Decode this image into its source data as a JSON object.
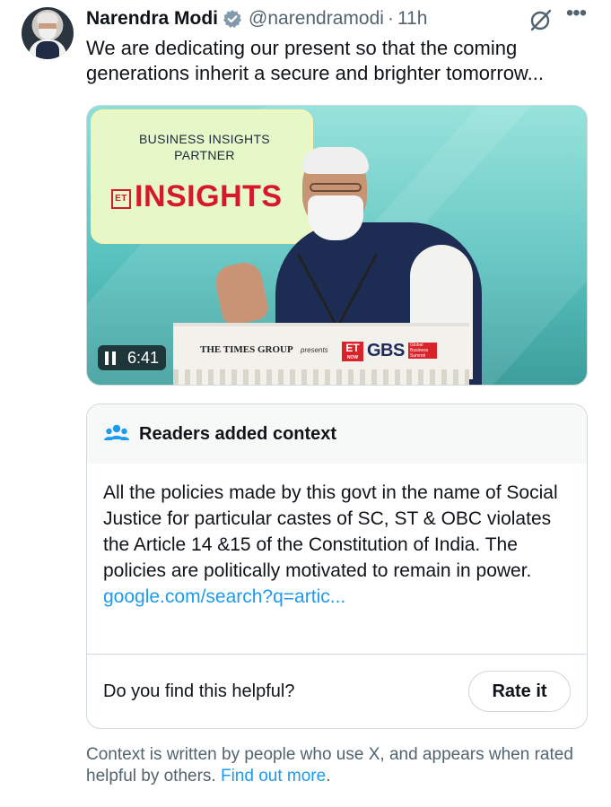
{
  "tweet": {
    "author_name": "Narendra Modi",
    "handle": "@narendramodi",
    "separator": "·",
    "time": "11h",
    "text": "We are dedicating our present so that the coming generations inherit a secure and brighter tomorrow...",
    "icons": [
      "verified-badge-icon",
      "grok-icon",
      "more-icon"
    ]
  },
  "media": {
    "duration": "6:41",
    "board_line1": "BUSINESS INSIGHTS",
    "board_line2": "PARTNER",
    "board_brand_mark": "ET",
    "board_brand": "INSIGHTS",
    "podium_times": "THE TIMES GROUP",
    "podium_presents": "presents",
    "podium_et": "ET",
    "podium_et_sub": "NOW",
    "podium_gbs": "GBS",
    "podium_gbs_tag": "Global Business Summit"
  },
  "context": {
    "title": "Readers added context",
    "body": "All the policies made by this govt in the name of Social Justice for particular castes of SC, ST & OBC violates the Article 14 &15 of the Constitution of India. The policies are politically motivated to remain in power.",
    "link": "google.com/search?q=artic...",
    "question": "Do you find this helpful?",
    "rate_label": "Rate it"
  },
  "footnote": {
    "text": "Context is written by people who use X, and appears when rated helpful by others. ",
    "link": "Find out more",
    "end": "."
  },
  "colors": {
    "link": "#1d9bf0",
    "verified": "#829aab",
    "secondary_text": "#536471",
    "context_header_bg": "#f7f9f9"
  }
}
